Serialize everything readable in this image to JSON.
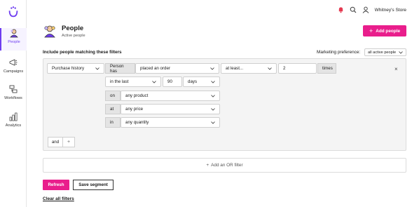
{
  "app": {
    "store_name": "Whitney's Store"
  },
  "sidebar": {
    "items": [
      {
        "label": "People",
        "icon": "people-icon",
        "active": true
      },
      {
        "label": "Campaigns",
        "icon": "megaphone-icon",
        "active": false
      },
      {
        "label": "Workflows",
        "icon": "workflow-icon",
        "active": false
      },
      {
        "label": "Analytics",
        "icon": "analytics-icon",
        "active": false
      }
    ]
  },
  "header": {
    "title": "People",
    "subtitle": "Active people",
    "add_button": "Add people"
  },
  "filters": {
    "include_label": "Include people matching these filters",
    "marketing_pref_label": "Marketing preference:",
    "marketing_pref_value": "all active people",
    "row1": {
      "category": "Purchase history",
      "person_has": "Person has",
      "action": "placed an order",
      "comparator": "at least...",
      "count": "2",
      "times": "times"
    },
    "row2": {
      "period": "in the last",
      "amount": "90",
      "unit": "days"
    },
    "row3": {
      "tag": "on",
      "value": "any product"
    },
    "row4": {
      "tag": "at",
      "value": "any price"
    },
    "row5": {
      "tag": "in",
      "value": "any quantity"
    },
    "and_label": "and",
    "and_plus": "+",
    "close": "×",
    "or_filter": "Add an OR filter"
  },
  "actions": {
    "refresh": "Refresh",
    "save_segment": "Save segment",
    "clear_filters": "Clear all filters"
  },
  "colors": {
    "accent": "#e91e8c",
    "brand": "#6e3df0"
  }
}
